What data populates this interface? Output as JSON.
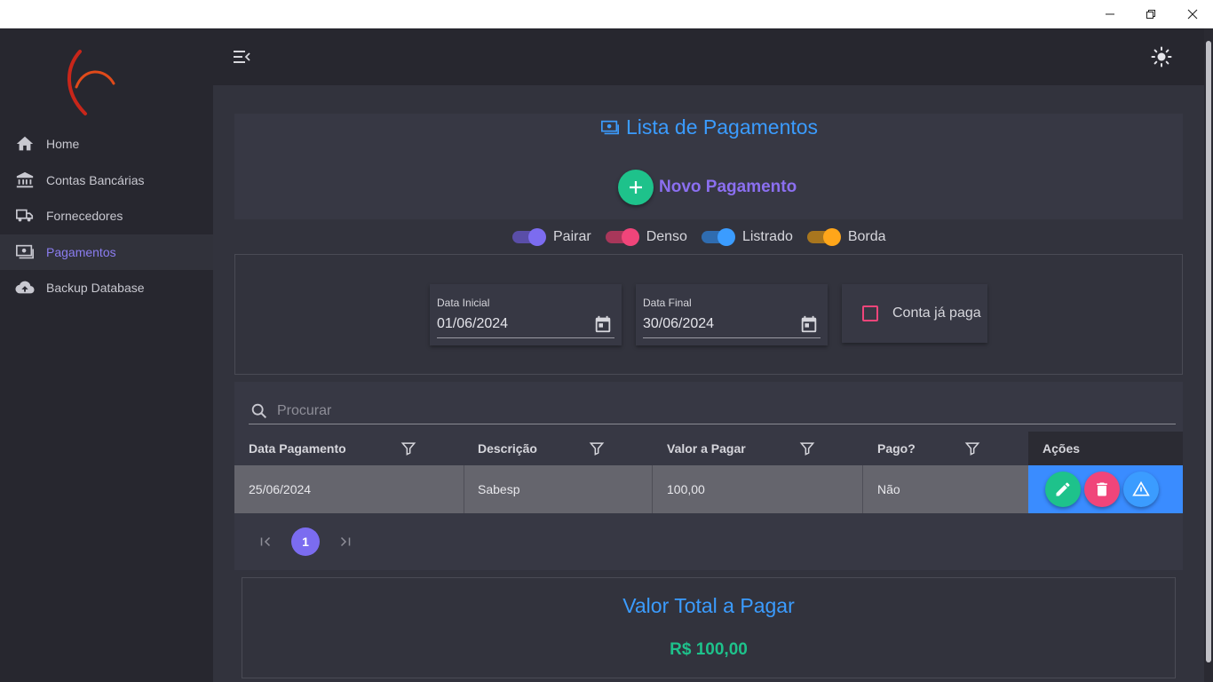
{
  "app": {
    "title": "Lista de Pagamentos",
    "colors": {
      "accent_blue": "#3b9cff",
      "accent_purple": "#8b6ff0",
      "green": "#1ec28b",
      "pink": "#f0457a",
      "orange": "#ffa61a"
    }
  },
  "window": {
    "controls": [
      "minimize-icon",
      "restore-icon",
      "close-icon"
    ]
  },
  "sidebar": {
    "items": [
      {
        "label": "Home",
        "icon": "home-icon",
        "active": false
      },
      {
        "label": "Contas Bancárias",
        "icon": "bank-icon",
        "active": false
      },
      {
        "label": "Fornecedores",
        "icon": "truck-icon",
        "active": false
      },
      {
        "label": "Pagamentos",
        "icon": "cash-icon",
        "active": true
      },
      {
        "label": "Backup Database",
        "icon": "cloud-upload-icon",
        "active": false
      }
    ]
  },
  "header": {
    "title": "Lista de Pagamentos",
    "new_button_label": "Novo Pagamento"
  },
  "toggles": [
    {
      "label": "Pairar",
      "on": true,
      "color": "#7c6cf0"
    },
    {
      "label": "Denso",
      "on": true,
      "color": "#f0457a"
    },
    {
      "label": "Listrado",
      "on": true,
      "color": "#3b9cff"
    },
    {
      "label": "Borda",
      "on": true,
      "color": "#ffa61a"
    }
  ],
  "filters": {
    "start_date": {
      "label": "Data Inicial",
      "value": "01/06/2024"
    },
    "end_date": {
      "label": "Data Final",
      "value": "30/06/2024"
    },
    "paid_checkbox": {
      "label": "Conta já paga",
      "checked": false
    }
  },
  "search": {
    "placeholder": "Procurar",
    "value": ""
  },
  "table": {
    "columns": [
      "Data Pagamento",
      "Descrição",
      "Valor a Pagar",
      "Pago?",
      "Ações"
    ],
    "rows": [
      {
        "date": "25/06/2024",
        "description": "Sabesp",
        "amount": "100,00",
        "paid": "Não"
      }
    ],
    "actions": [
      "edit-icon",
      "delete-icon",
      "alert-icon"
    ]
  },
  "pagination": {
    "current_page": "1"
  },
  "total": {
    "title": "Valor Total a Pagar",
    "value": "R$ 100,00"
  }
}
